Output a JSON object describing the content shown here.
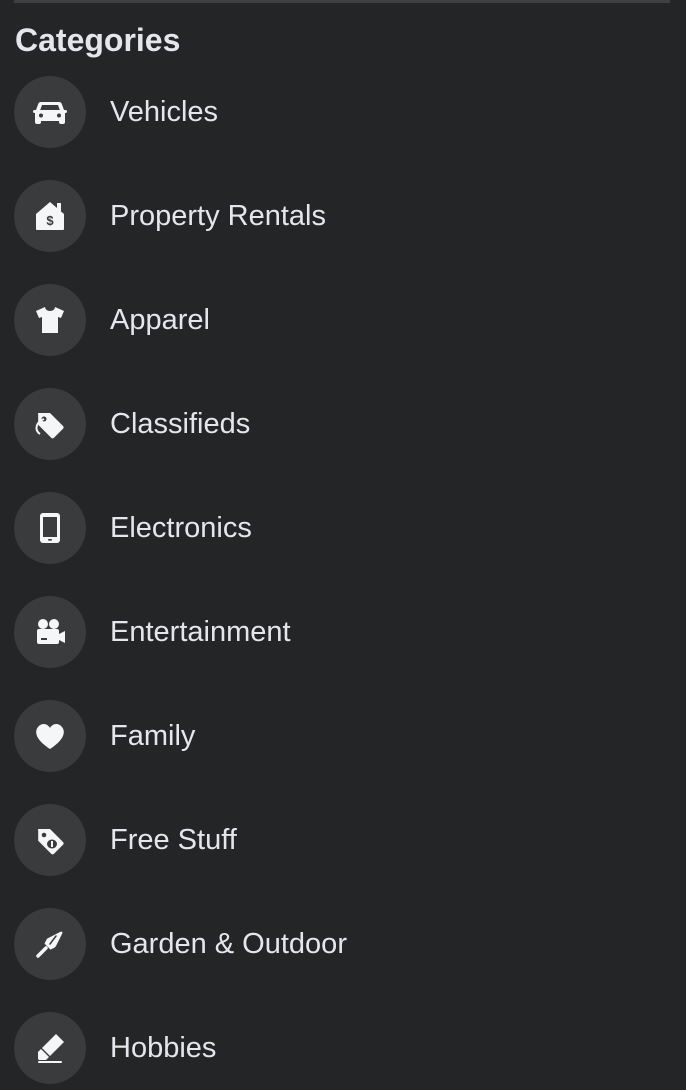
{
  "section": {
    "title": "Categories"
  },
  "categories": [
    {
      "label": "Vehicles",
      "icon": "car-icon"
    },
    {
      "label": "Property Rentals",
      "icon": "house-dollar-icon"
    },
    {
      "label": "Apparel",
      "icon": "tshirt-icon"
    },
    {
      "label": "Classifieds",
      "icon": "tag-icon"
    },
    {
      "label": "Electronics",
      "icon": "tablet-icon"
    },
    {
      "label": "Entertainment",
      "icon": "video-camera-icon"
    },
    {
      "label": "Family",
      "icon": "heart-icon"
    },
    {
      "label": "Free Stuff",
      "icon": "free-tag-icon"
    },
    {
      "label": "Garden & Outdoor",
      "icon": "trowel-icon"
    },
    {
      "label": "Hobbies",
      "icon": "marker-icon"
    }
  ],
  "colors": {
    "background": "#242526",
    "icon_circle": "#3A3B3C",
    "text": "#E4E6EB",
    "divider": "#3E4042"
  }
}
